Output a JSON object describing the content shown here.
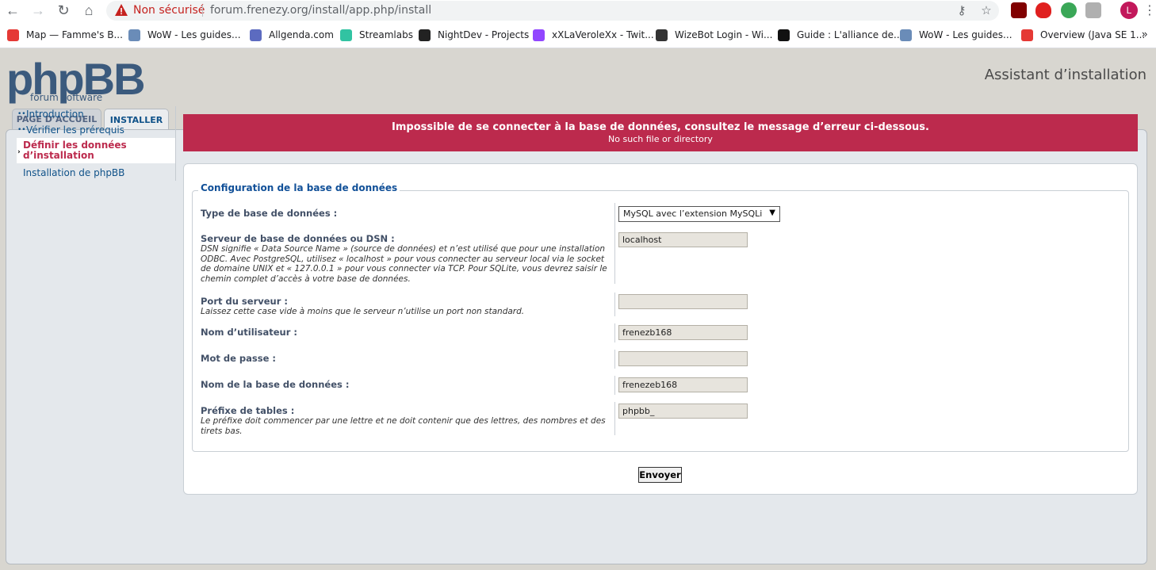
{
  "browser": {
    "not_secure": "Non sécurisé",
    "url": "forum.frenezy.org/install/app.php/install",
    "profile_initial": "L",
    "bookmarks": [
      {
        "label": "Map — Famme's B...",
        "color": "#e53935"
      },
      {
        "label": "WoW - Les guides...",
        "color": "#6a8cb8"
      },
      {
        "label": "Allgenda.com",
        "color": "#5c6bc0"
      },
      {
        "label": "Streamlabs",
        "color": "#31c3a2"
      },
      {
        "label": "NightDev - Projects",
        "color": "#222222"
      },
      {
        "label": "xXLaVeroleXx - Twit...",
        "color": "#9146ff"
      },
      {
        "label": "WizeBot Login - Wi...",
        "color": "#333333"
      },
      {
        "label": "Guide : L'alliance de...",
        "color": "#111111"
      },
      {
        "label": "WoW - Les guides...",
        "color": "#6a8cb8"
      },
      {
        "label": "Overview (Java SE 1...",
        "color": "#e53935"
      }
    ],
    "more": "»"
  },
  "header": {
    "logo_main": "phpBB",
    "logo_sub": "forum software",
    "site_title": "Assistant d’installation"
  },
  "tabs": [
    {
      "label": "PAGE D’ACCUEIL"
    },
    {
      "label": "INSTALLER"
    }
  ],
  "sidebar": {
    "items": [
      {
        "label": "Introduction"
      },
      {
        "label": "Vérifier les prérequis"
      },
      {
        "label": "Définir les données d’installation"
      },
      {
        "label": "Installation de phpBB"
      }
    ]
  },
  "error": {
    "title": "Impossible de se connecter à la base de données, consultez le message d’erreur ci-dessous.",
    "message": "No such file or directory"
  },
  "form": {
    "legend": "Configuration de la base de données",
    "db_type": {
      "label": "Type de base de données :",
      "value": "MySQL avec l’extension MySQLi"
    },
    "server": {
      "label": "Serveur de base de données ou DSN :",
      "explain": "DSN signifie « Data Source Name » (source de données) et n’est utilisé que pour une installation ODBC. Avec PostgreSQL, utilisez « localhost » pour vous connecter au serveur local via le socket de domaine UNIX et « 127.0.0.1 » pour vous connecter via TCP. Pour SQLite, vous devrez saisir le chemin complet d’accès à votre base de données.",
      "value": "localhost"
    },
    "port": {
      "label": "Port du serveur :",
      "explain": "Laissez cette case vide à moins que le serveur n’utilise un port non standard.",
      "value": ""
    },
    "user": {
      "label": "Nom d’utilisateur :",
      "value": "frenezb168"
    },
    "password": {
      "label": "Mot de passe :",
      "value": ""
    },
    "db_name": {
      "label": "Nom de la base de données :",
      "value": "frenezeb168"
    },
    "prefix": {
      "label": "Préfixe de tables :",
      "explain": "Le préfixe doit commencer par une lettre et ne doit contenir que des lettres, des nombres et des tirets bas.",
      "value": "phpbb_"
    },
    "submit": "Envoyer"
  }
}
